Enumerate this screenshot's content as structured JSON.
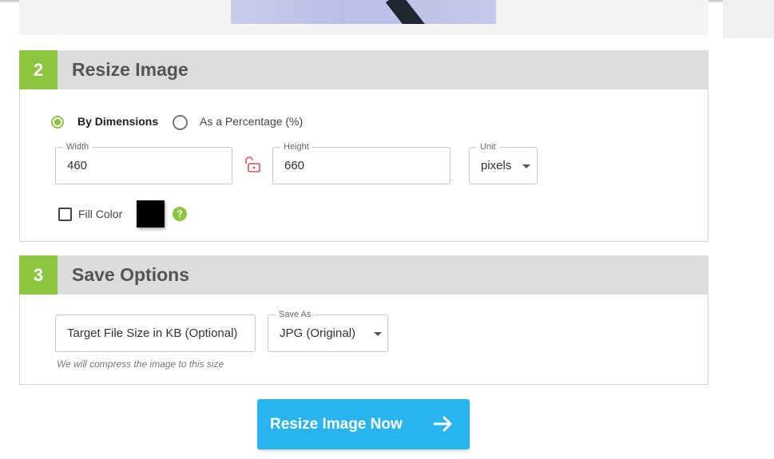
{
  "resize_section": {
    "step": "2",
    "title": "Resize Image",
    "mode_dimensions_label": "By Dimensions",
    "mode_percentage_label": "As a Percentage (%)",
    "width": {
      "label": "Width",
      "value": "460"
    },
    "height": {
      "label": "Height",
      "value": "660"
    },
    "unit": {
      "label": "Unit",
      "value": "pixels"
    },
    "fill_color": {
      "label": "Fill Color",
      "color": "#000000",
      "help": "?"
    }
  },
  "save_section": {
    "step": "3",
    "title": "Save Options",
    "target_size_placeholder": "Target File Size in KB (Optional)",
    "target_size_hint": "We will compress the image to this size",
    "save_as": {
      "label": "Save As",
      "value": "JPG (Original)"
    }
  },
  "cta": {
    "label": "Resize Image Now"
  },
  "colors": {
    "accent_green": "#8cc63f",
    "button_blue": "#28b4ec",
    "lock_red": "#e05050"
  }
}
